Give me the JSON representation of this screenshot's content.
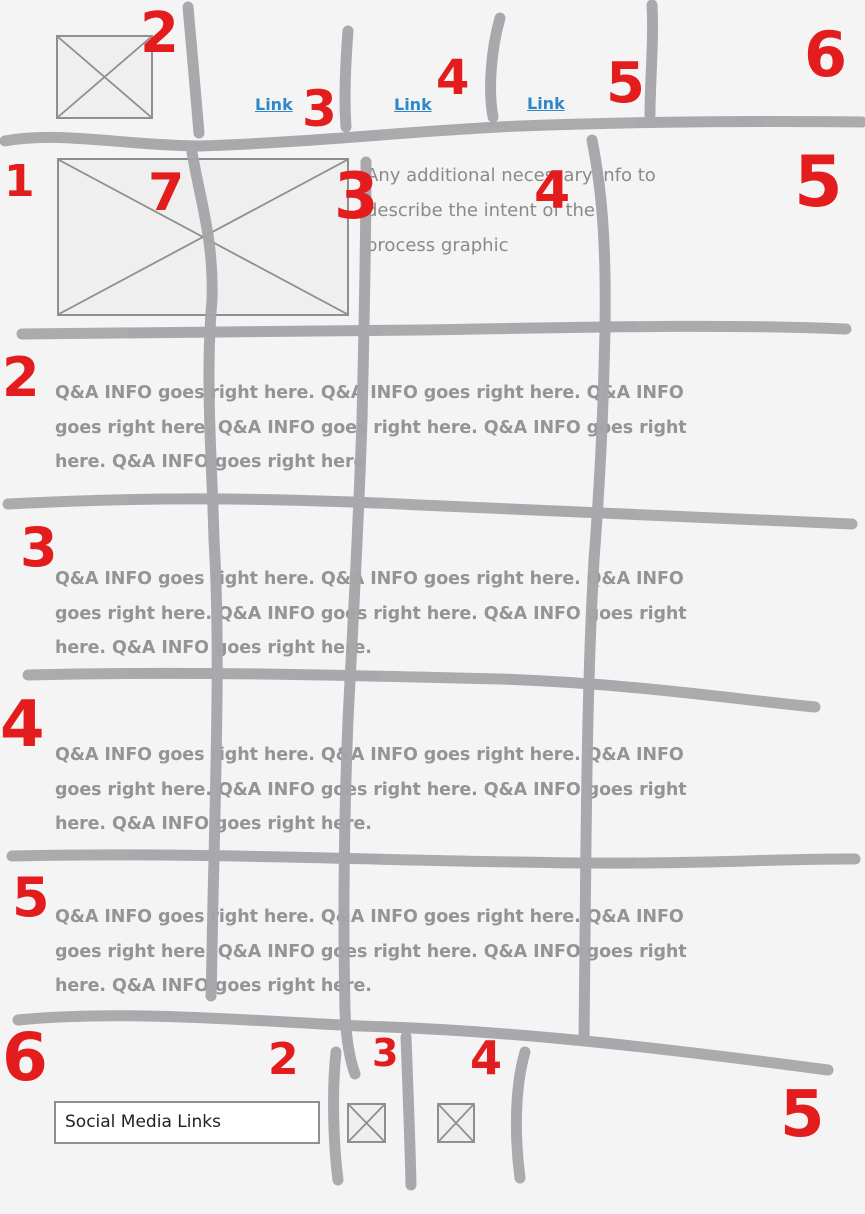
{
  "header": {
    "nav_links": [
      "Link",
      "Link",
      "Link"
    ]
  },
  "hero": {
    "info_text": "Any additional necessary info to describe the intent of the process graphic"
  },
  "qa_sections": [
    {
      "text": "Q&A INFO goes right here. Q&A INFO goes right here. Q&A INFO goes right here. Q&A INFO goes right here. Q&A INFO goes right here. Q&A INFO goes right here"
    },
    {
      "text": "Q&A INFO goes right here. Q&A INFO goes right here. Q&A INFO goes right here. Q&A INFO goes right here. Q&A INFO goes right here. Q&A INFO goes right here."
    },
    {
      "text": "Q&A INFO goes right here. Q&A INFO goes right here. Q&A INFO goes right here. Q&A INFO goes right here. Q&A INFO goes right here. Q&A INFO goes right here."
    },
    {
      "text": "Q&A INFO goes right here. Q&A INFO goes right here. Q&A INFO goes right here. Q&A INFO goes right here. Q&A INFO goes right here. Q&A INFO goes right here."
    }
  ],
  "footer": {
    "social_label": "Social Media Links"
  },
  "annotations": {
    "row_numbers": [
      "1",
      "2",
      "3",
      "4",
      "5",
      "6"
    ],
    "column_numbers_top": [
      "2",
      "3",
      "4",
      "5",
      "6"
    ],
    "column_numbers_hero": [
      "7",
      "3",
      "4",
      "5"
    ],
    "column_numbers_footer": [
      "2",
      "3",
      "4",
      "5"
    ]
  },
  "colors": {
    "annotation_red": "#e31d1d",
    "grid_line_gray": "#a6a6aa",
    "link_blue": "#2f86c9",
    "text_gray": "#949494",
    "background": "#f4f4f4"
  }
}
